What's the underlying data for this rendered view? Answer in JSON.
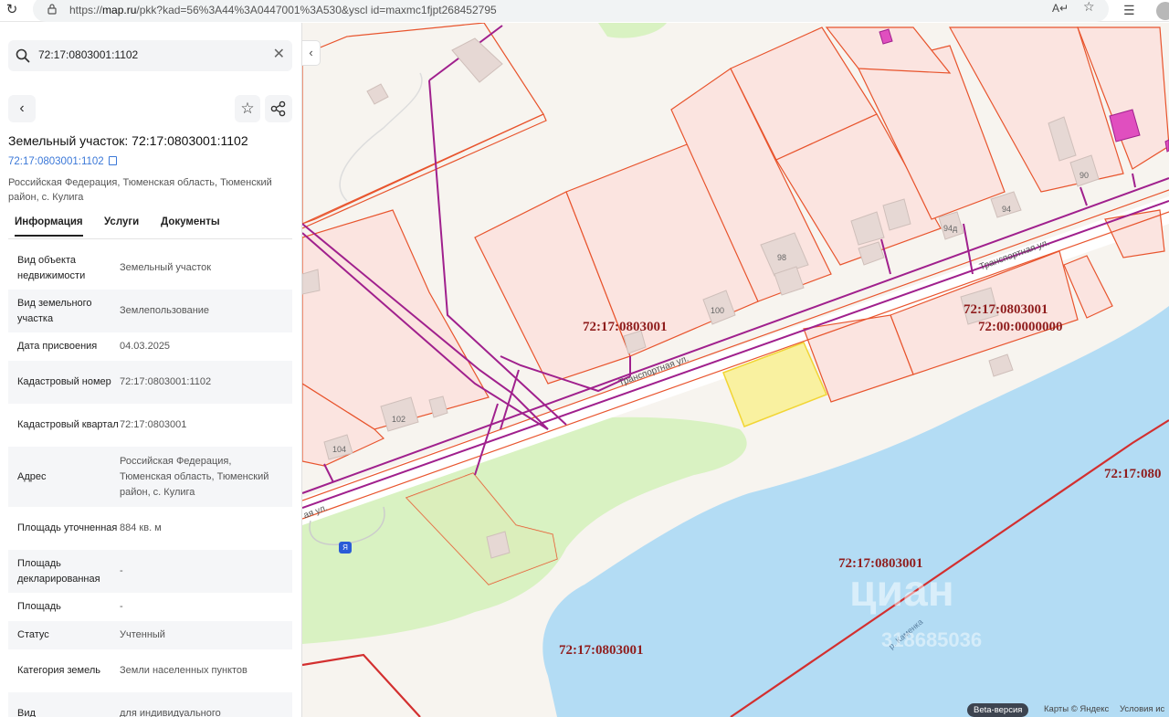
{
  "browser": {
    "url_prefix": "https://",
    "url_host": "map.ru",
    "url_path": "/pkk?kad=56%3A44%3A0447001%3A530&yscl id=maxmc1fjpt268452795"
  },
  "search": {
    "value": "72:17:0803001:1102"
  },
  "object": {
    "title": "Земельный участок: 72:17:0803001:1102",
    "cad_link": "72:17:0803001:1102",
    "address": "Российская Федерация, Тюменская область, Тюменский район, с. Кулига"
  },
  "tabs": [
    {
      "label": "Информация"
    },
    {
      "label": "Услуги"
    },
    {
      "label": "Документы"
    }
  ],
  "info_rows": [
    {
      "key": "Вид объекта недвижимости",
      "value": "Земельный участок"
    },
    {
      "key": "Вид земельного участка",
      "value": "Землепользование"
    },
    {
      "key": "Дата присвоения",
      "value": "04.03.2025"
    },
    {
      "key": "Кадастровый номер",
      "value": "72:17:0803001:1102"
    },
    {
      "key": "Кадастровый квартал",
      "value": "72:17:0803001"
    },
    {
      "key": "Адрес",
      "value": "Российская Федерация, Тюменская область, Тюменский район, с. Кулига"
    },
    {
      "key": "Площадь уточненная",
      "value": "884 кв. м"
    },
    {
      "key": "Площадь декларированная",
      "value": "-"
    },
    {
      "key": "Площадь",
      "value": "-"
    },
    {
      "key": "Статус",
      "value": "Учтенный"
    },
    {
      "key": "Категория земель",
      "value": "Земли населенных пунктов"
    },
    {
      "key": "Вид",
      "value": "для индивидуального"
    }
  ],
  "map": {
    "cad_labels": {
      "q1": "72:17:0803001",
      "q2": "72:17:0803001",
      "q3": "72:00:0000000",
      "q4": "72:17:080",
      "q5": "72:17:0803001",
      "q6": "72:17:0803001"
    },
    "streets": {
      "s1": "Транспортная ул.",
      "s2": "Транспортная ул.",
      "s3": "ая ул."
    },
    "houses": {
      "h90": "90",
      "h94": "94",
      "h94a": "94д",
      "h98": "98",
      "h100": "100",
      "h102": "102",
      "h104": "104"
    },
    "river": "р. Каменка",
    "watermark": "циан",
    "watermark_id": "318685036",
    "beta": "Beta-версия",
    "footer_maps": "Карты © Яндекс",
    "footer_terms": "Условия ис",
    "bus_stop": "Я"
  },
  "colors": {
    "water": "#b3dcf4",
    "park": "#d9f2c2",
    "parcel_fill": "#fbe4e0",
    "parcel_stroke": "#e8542d",
    "selected_parcel": "#f9f1a0",
    "utility_line": "#a0208d",
    "boundary_red": "#d32f2f",
    "link": "#3b78d8"
  }
}
